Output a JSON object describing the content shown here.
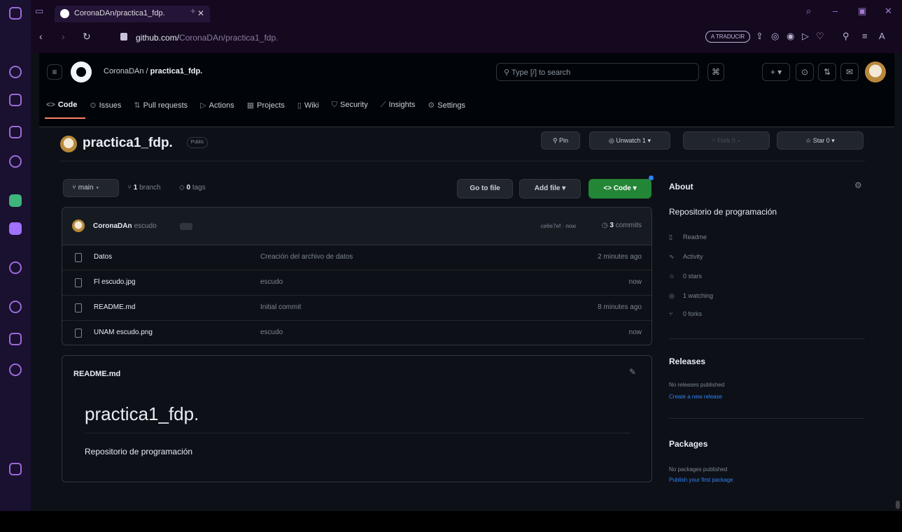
{
  "browser": {
    "tab_title": "CoronaDAn/practica1_fdp.",
    "url_host": "github.com/",
    "url_path": "CoronaDAn/practica1_fdp.",
    "translate_label": "A TRADUCIR"
  },
  "header": {
    "owner": "CoronaDAn",
    "separator": " / ",
    "repo": "practica1_fdp.",
    "search_placeholder": "Type [/] to search"
  },
  "repo_nav": {
    "tabs": [
      {
        "label": "Code",
        "icon": "code-icon"
      },
      {
        "label": "Issues",
        "icon": "issue-icon"
      },
      {
        "label": "Pull requests",
        "icon": "pull-request-icon"
      },
      {
        "label": "Actions",
        "icon": "play-icon"
      },
      {
        "label": "Projects",
        "icon": "table-icon"
      },
      {
        "label": "Wiki",
        "icon": "book-icon"
      },
      {
        "label": "Security",
        "icon": "shield-icon"
      },
      {
        "label": "Insights",
        "icon": "graph-icon"
      },
      {
        "label": "Settings",
        "icon": "gear-icon"
      }
    ]
  },
  "repo_head": {
    "name": "practica1_fdp.",
    "visibility": "Public",
    "pin_label": "Pin",
    "unwatch_label": "Unwatch",
    "unwatch_count": "1",
    "fork_label": "Fork",
    "fork_count": "0",
    "star_label": "Star",
    "star_count": "0"
  },
  "toolbar": {
    "branch": "main",
    "branch_count": "1",
    "branch_word": "branch",
    "tag_count": "0",
    "tag_word": "tags",
    "go_to_file": "Go to file",
    "add_file": "Add file",
    "code": "Code"
  },
  "commit": {
    "author": "CoronaDAn",
    "message": "escudo",
    "hash": "ce6e7ef",
    "time": "now",
    "count": "3",
    "count_word": "commits"
  },
  "files": [
    {
      "name": "Datos",
      "message": "Creación del archivo de datos",
      "time": "2 minutes ago"
    },
    {
      "name": "Fl escudo.jpg",
      "message": "escudo",
      "time": "now"
    },
    {
      "name": "README.md",
      "message": "Initial commit",
      "time": "8 minutes ago"
    },
    {
      "name": "UNAM escudo.png",
      "message": "escudo",
      "time": "now"
    }
  ],
  "readme": {
    "filename": "README.md",
    "heading": "practica1_fdp.",
    "body": "Repositorio de programación"
  },
  "about": {
    "title": "About",
    "description": "Repositorio de programación",
    "readme": "Readme",
    "activity": "Activity",
    "stars": "0 stars",
    "watching": "1 watching",
    "forks": "0 forks"
  },
  "releases": {
    "title": "Releases",
    "none": "No releases published",
    "link": "Create a new release"
  },
  "packages": {
    "title": "Packages",
    "none": "No packages published",
    "link": "Publish your first package"
  },
  "colors": {
    "code_button": "#238636",
    "link": "#2f81f7",
    "active_tab_underline": "#f78166",
    "background": "#0d1117"
  }
}
